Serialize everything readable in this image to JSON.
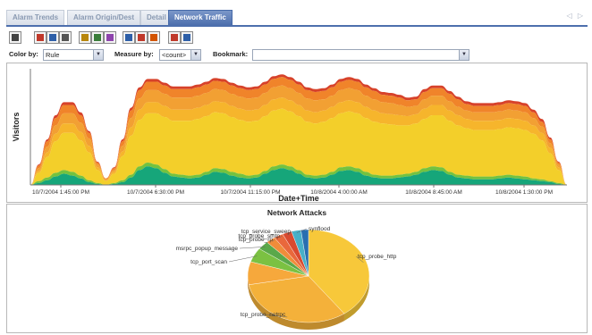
{
  "tabs": [
    {
      "label": "Alarm Trends",
      "active": false
    },
    {
      "label": "Alarm Origin/Dest",
      "active": false
    },
    {
      "label": "Detail",
      "active": false
    },
    {
      "label": "Network Traffic",
      "active": true
    }
  ],
  "tab_scroll_glyph": "◁ ▷",
  "toolbar": {
    "buttons": [
      {
        "name": "home-icon",
        "color": "#444444"
      },
      {
        "name": "chart-type-icon",
        "color": "#c0392b"
      },
      {
        "name": "chart-type-2-icon",
        "color": "#2e5fa8"
      },
      {
        "name": "chart-type-3-icon",
        "color": "#555555"
      },
      {
        "name": "bar-chart-icon",
        "color": "#b8860b"
      },
      {
        "name": "column-chart-icon",
        "color": "#3a7d3a"
      },
      {
        "name": "stack-chart-icon",
        "color": "#8e44ad"
      },
      {
        "name": "area-chart-icon",
        "color": "#2e5fa8"
      },
      {
        "name": "line-chart-icon",
        "color": "#c0392b"
      },
      {
        "name": "pie-chart-icon",
        "color": "#d35400"
      },
      {
        "name": "legend-icon",
        "color": "#c0392b"
      },
      {
        "name": "list-icon",
        "color": "#2e5fa8"
      }
    ]
  },
  "controls": {
    "color_by_label": "Color by:",
    "color_by_value": "Rule",
    "measure_by_label": "Measure by:",
    "measure_by_value": "<count>",
    "bookmark_label": "Bookmark:",
    "bookmark_value": ""
  },
  "chart_data": [
    {
      "type": "area",
      "title": "",
      "xlabel": "Date+Time",
      "ylabel": "Visitors",
      "x_ticks": [
        "10/7/2004 1:45:00 PM",
        "10/7/2004 6:30:00 PM",
        "10/7/2004 11:15:00 PM",
        "10/8/2004 4:00:00 AM",
        "10/8/2004 8:45:00 AM",
        "10/8/2004 1:30:00 PM"
      ],
      "stacked": true,
      "grid": false,
      "colors": [
        "#16a67a",
        "#74c23f",
        "#f3cf2a",
        "#f6b52c",
        "#f2a033",
        "#f0842a",
        "#d7422a"
      ],
      "x": [
        0,
        1,
        2,
        3,
        4,
        5,
        6,
        7,
        8,
        9,
        10,
        11,
        12,
        13,
        14,
        15,
        16,
        17,
        18,
        19,
        20,
        21,
        22,
        23,
        24,
        25,
        26,
        27,
        28,
        29,
        30,
        31,
        32,
        33,
        34,
        35,
        36,
        37,
        38,
        39,
        40,
        41,
        42,
        43,
        44,
        45,
        46,
        47,
        48,
        49,
        50,
        51,
        52,
        53,
        54,
        55,
        56,
        57,
        58,
        59,
        60,
        61,
        62,
        63,
        64
      ],
      "series": [
        {
          "values": [
            0,
            2,
            5,
            9,
            12,
            10,
            7,
            3,
            1,
            0,
            1,
            3,
            8,
            16,
            20,
            18,
            13,
            9,
            8,
            7,
            8,
            11,
            14,
            13,
            10,
            8,
            7,
            8,
            12,
            16,
            18,
            16,
            12,
            8,
            7,
            8,
            11,
            15,
            16,
            14,
            10,
            8,
            7,
            7,
            8,
            9,
            11,
            14,
            16,
            15,
            11,
            8,
            7,
            6,
            6,
            6,
            7,
            8,
            7,
            6,
            5,
            4,
            3,
            1,
            0
          ]
        },
        {
          "values": [
            0,
            2,
            3,
            4,
            4,
            4,
            3,
            2,
            1,
            0,
            1,
            2,
            3,
            4,
            4,
            4,
            4,
            3,
            3,
            3,
            3,
            3,
            4,
            4,
            4,
            4,
            3,
            3,
            3,
            4,
            4,
            4,
            4,
            3,
            3,
            3,
            3,
            4,
            4,
            4,
            4,
            3,
            3,
            3,
            3,
            3,
            3,
            4,
            4,
            4,
            3,
            3,
            3,
            3,
            3,
            3,
            3,
            3,
            3,
            3,
            2,
            2,
            1,
            1,
            0
          ]
        },
        {
          "values": [
            0,
            9,
            22,
            34,
            40,
            42,
            38,
            30,
            14,
            4,
            10,
            26,
            42,
            50,
            53,
            55,
            56,
            57,
            58,
            59,
            60,
            60,
            60,
            60,
            59,
            58,
            58,
            58,
            59,
            60,
            60,
            59,
            58,
            57,
            56,
            57,
            58,
            58,
            59,
            59,
            58,
            57,
            56,
            55,
            53,
            52,
            52,
            53,
            55,
            56,
            55,
            53,
            51,
            50,
            50,
            50,
            50,
            51,
            51,
            50,
            48,
            42,
            30,
            14,
            0
          ]
        },
        {
          "values": [
            0,
            2,
            5,
            8,
            10,
            10,
            9,
            7,
            3,
            1,
            2,
            5,
            9,
            11,
            12,
            12,
            12,
            12,
            12,
            12,
            12,
            12,
            12,
            12,
            12,
            12,
            12,
            12,
            12,
            12,
            12,
            12,
            12,
            12,
            12,
            12,
            12,
            12,
            12,
            12,
            12,
            12,
            11,
            11,
            11,
            10,
            10,
            11,
            11,
            11,
            11,
            11,
            10,
            10,
            10,
            10,
            10,
            10,
            10,
            10,
            9,
            8,
            6,
            3,
            0
          ]
        },
        {
          "values": [
            0,
            3,
            6,
            9,
            11,
            11,
            10,
            8,
            3,
            1,
            2,
            6,
            10,
            12,
            13,
            13,
            13,
            13,
            13,
            13,
            13,
            13,
            13,
            13,
            13,
            13,
            13,
            13,
            13,
            13,
            13,
            13,
            13,
            13,
            13,
            12,
            12,
            13,
            13,
            13,
            12,
            12,
            12,
            12,
            11,
            10,
            9,
            10,
            10,
            10,
            10,
            9,
            9,
            9,
            9,
            9,
            9,
            9,
            9,
            9,
            8,
            7,
            5,
            3,
            0
          ]
        },
        {
          "values": [
            0,
            3,
            6,
            8,
            9,
            9,
            8,
            6,
            2,
            1,
            2,
            5,
            8,
            9,
            9,
            9,
            9,
            9,
            9,
            9,
            9,
            9,
            9,
            9,
            9,
            9,
            9,
            9,
            9,
            9,
            9,
            9,
            9,
            9,
            9,
            9,
            9,
            9,
            9,
            9,
            9,
            9,
            8,
            8,
            8,
            7,
            7,
            8,
            8,
            8,
            8,
            8,
            7,
            7,
            7,
            7,
            7,
            7,
            7,
            7,
            6,
            5,
            4,
            2,
            0
          ]
        },
        {
          "values": [
            0,
            1,
            2,
            3,
            3,
            3,
            3,
            2,
            1,
            0,
            1,
            2,
            3,
            3,
            3,
            3,
            3,
            3,
            3,
            3,
            3,
            3,
            3,
            3,
            3,
            3,
            3,
            3,
            3,
            3,
            3,
            3,
            3,
            3,
            3,
            3,
            3,
            3,
            3,
            3,
            3,
            3,
            3,
            3,
            3,
            3,
            3,
            3,
            3,
            3,
            3,
            3,
            3,
            3,
            3,
            3,
            3,
            3,
            3,
            3,
            3,
            3,
            2,
            1,
            0
          ]
        }
      ]
    },
    {
      "type": "pie",
      "title": "Network Attacks",
      "colors": [
        "#f7c83a",
        "#f4b13a",
        "#f6a83c",
        "#7bc142",
        "#5aa84a",
        "#f08c3a",
        "#e9683c",
        "#d94a30",
        "#48b0c8",
        "#2a6fb0"
      ],
      "slices": [
        {
          "label": "tcp_probe_http",
          "value": 40
        },
        {
          "label": "tcp_probe_netrpc",
          "value": 32
        },
        {
          "label": "",
          "value": 8
        },
        {
          "label": "tcp_port_scan",
          "value": 5
        },
        {
          "label": "msrpc_popup_message",
          "value": 3
        },
        {
          "label": "tcp_probe_rp",
          "value": 2.5
        },
        {
          "label": "tcp_probe_smtp",
          "value": 2.5
        },
        {
          "label": "tcp_service_sweep",
          "value": 2.5
        },
        {
          "label": "synflood",
          "value": 2.5
        },
        {
          "label": "",
          "value": 2
        }
      ]
    }
  ]
}
